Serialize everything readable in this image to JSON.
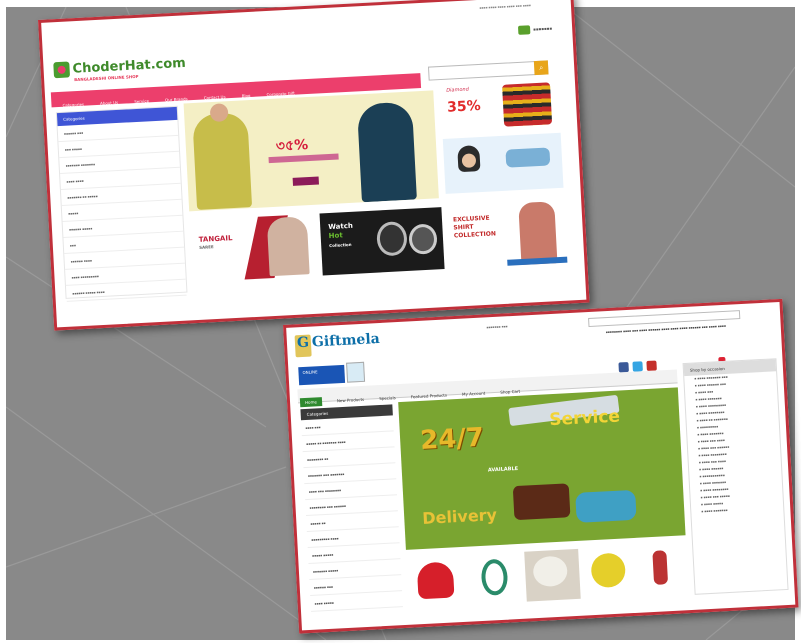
{
  "colors": {
    "background": "#898989",
    "frame_border": "#c0303a",
    "card1_nav": "#ec3f6c",
    "card1_sidebar_header": "#3f55d6",
    "card2_accent": "#2f8a2f",
    "card2_logo": "#0d6fa8"
  },
  "card1": {
    "logo": "ChoderHat.com",
    "logo_sub": "BANGLADESHI ONLINE SHOP",
    "nav": [
      "Categories",
      "About Us",
      "Service",
      "Our Brands",
      "Contact Us",
      "Blog",
      "Corporate Gift"
    ],
    "sidebar_header": "Categories",
    "discount": "35%",
    "discount_label": "Diamond",
    "tangail_title": "TANGAIL",
    "tangail_sub": "SAREE",
    "watch_title": "Watch",
    "watch_hot": "Hot",
    "watch_sub": "Collection",
    "shirt_title": "EXCLUSIVE SHIRT COLLECTION"
  },
  "card2": {
    "logo": "Giftmela",
    "online_label": "ONLINE",
    "nav": [
      "Home",
      "New Products",
      "Specials",
      "Featured Products",
      "My Account",
      "Shop Cart"
    ],
    "categories_header": "Categories",
    "shop_by_header": "Shop by occasion",
    "banner_24": "24/7",
    "banner_service": "Service",
    "banner_available": "AVAILABLE",
    "banner_delivery": "Delivery"
  }
}
